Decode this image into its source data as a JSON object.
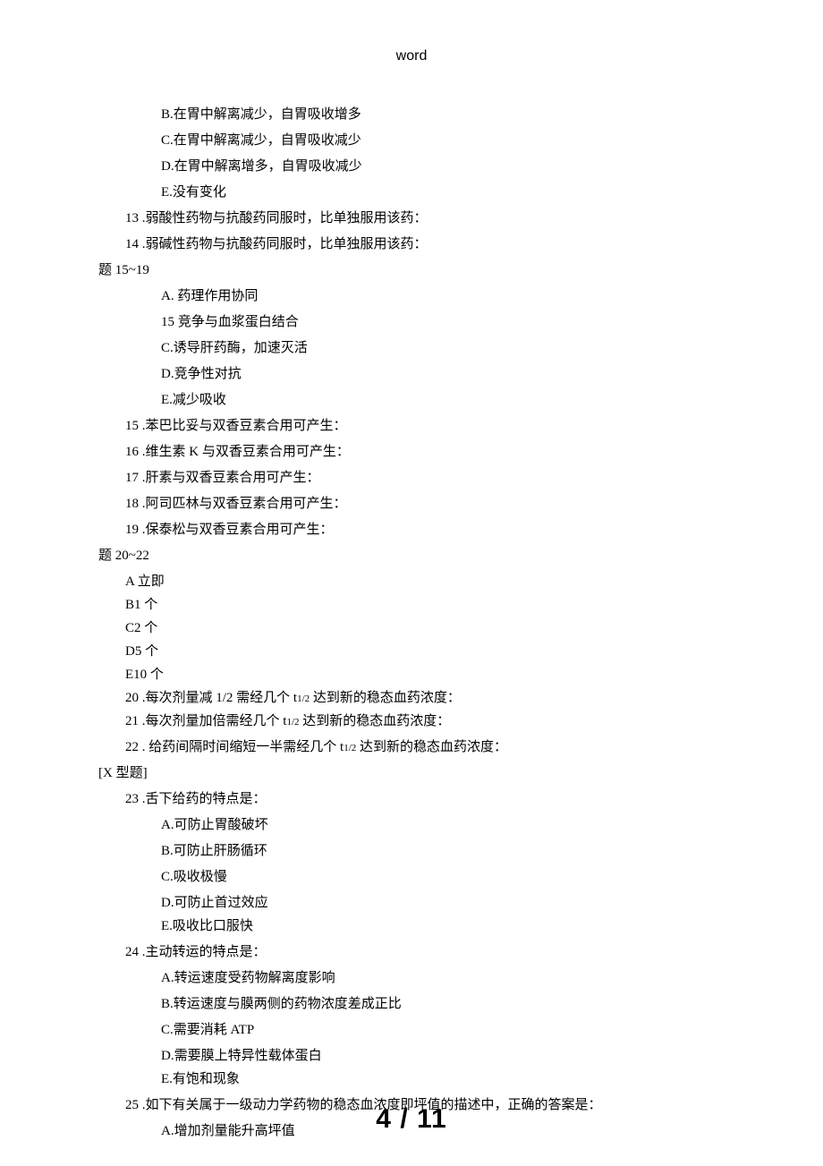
{
  "header": "word",
  "lines": [
    {
      "cls": "indent-1 line",
      "text": "B.在胃中解离减少，自胃吸收增多"
    },
    {
      "cls": "indent-1 line",
      "text": "C.在胃中解离减少，自胃吸收减少"
    },
    {
      "cls": "indent-1 line",
      "text": "D.在胃中解离增多，自胃吸收减少"
    },
    {
      "cls": "indent-1 line",
      "text": "E.没有变化"
    },
    {
      "cls": "indent-0 line",
      "text": "13 .弱酸性药物与抗酸药同服时，比单独服用该药："
    },
    {
      "cls": "indent-0 line",
      "text": "14 .弱碱性药物与抗酸药同服时，比单独服用该药："
    },
    {
      "cls": "noindent line",
      "text": "题 15~19"
    },
    {
      "cls": "indent-1 line",
      "text": "A. 药理作用协同"
    },
    {
      "cls": "indent-1 line",
      "text": "15  竞争与血浆蛋白结合"
    },
    {
      "cls": "indent-1 line",
      "text": "C.诱导肝药酶，加速灭活"
    },
    {
      "cls": "indent-1 line",
      "text": "D.竞争性对抗"
    },
    {
      "cls": "indent-1 line",
      "text": "E.减少吸收"
    },
    {
      "cls": "indent-0 line",
      "text": "15 .苯巴比妥与双香豆素合用可产生："
    },
    {
      "cls": "indent-0 line",
      "text": "16 .维生素 K 与双香豆素合用可产生："
    },
    {
      "cls": "indent-0 line",
      "text": "17 .肝素与双香豆素合用可产生："
    },
    {
      "cls": "indent-0 line",
      "text": "18 .阿司匹林与双香豆素合用可产生："
    },
    {
      "cls": "indent-0 line",
      "text": "19 .保泰松与双香豆素合用可产生："
    },
    {
      "cls": "noindent line",
      "text": "题 20~22"
    },
    {
      "cls": "indent-0 tight",
      "text": "A 立即"
    },
    {
      "cls": "indent-0 tight",
      "text": "B1 个"
    },
    {
      "cls": "indent-0 tight",
      "text": "C2 个"
    },
    {
      "cls": "indent-0 tight",
      "text": "D5 个"
    },
    {
      "cls": "indent-0 tight",
      "text": "E10 个"
    },
    {
      "cls": "indent-0 tight",
      "text": "20 .每次剂量减 1/2 需经几个 t1/2 达到新的稳态血药浓度："
    },
    {
      "cls": "indent-0 tight",
      "text": "21 .每次剂量加倍需经几个 t1/2 达到新的稳态血药浓度："
    },
    {
      "cls": "indent-0 line",
      "text": "22 . 给药间隔时间缩短一半需经几个 t1/2 达到新的稳态血药浓度："
    },
    {
      "cls": "noindent line",
      "text": "[X 型题]"
    },
    {
      "cls": "indent-0 line",
      "text": "23 .舌下给药的特点是："
    },
    {
      "cls": "indent-1 line",
      "text": "A.可防止胃酸破坏"
    },
    {
      "cls": "indent-1 line",
      "text": "B.可防止肝肠循环"
    },
    {
      "cls": "indent-1 line",
      "text": "C.吸收极慢"
    },
    {
      "cls": "indent-1 tight",
      "text": "D.可防止首过效应"
    },
    {
      "cls": "indent-1 tight",
      "text": "E.吸收比口服快"
    },
    {
      "cls": "indent-0 line",
      "text": "24 .主动转运的特点是："
    },
    {
      "cls": "indent-1 line",
      "text": "A.转运速度受药物解离度影响"
    },
    {
      "cls": "indent-1 line",
      "text": "B.转运速度与膜两侧的药物浓度差成正比"
    },
    {
      "cls": "indent-1 line",
      "text": "C.需要消耗 ATP"
    },
    {
      "cls": "indent-1 tight",
      "text": "D.需要膜上特异性载体蛋白"
    },
    {
      "cls": "indent-1 tight",
      "text": "E.有饱和现象"
    },
    {
      "cls": "indent-0 line",
      "text": "25 .如下有关属于一级动力学药物的稳态血浓度即坪值的描述中，正确的答案是："
    },
    {
      "cls": "indent-1 line",
      "text": "A.增加剂量能升高坪值"
    }
  ],
  "footer": "4 / 11"
}
